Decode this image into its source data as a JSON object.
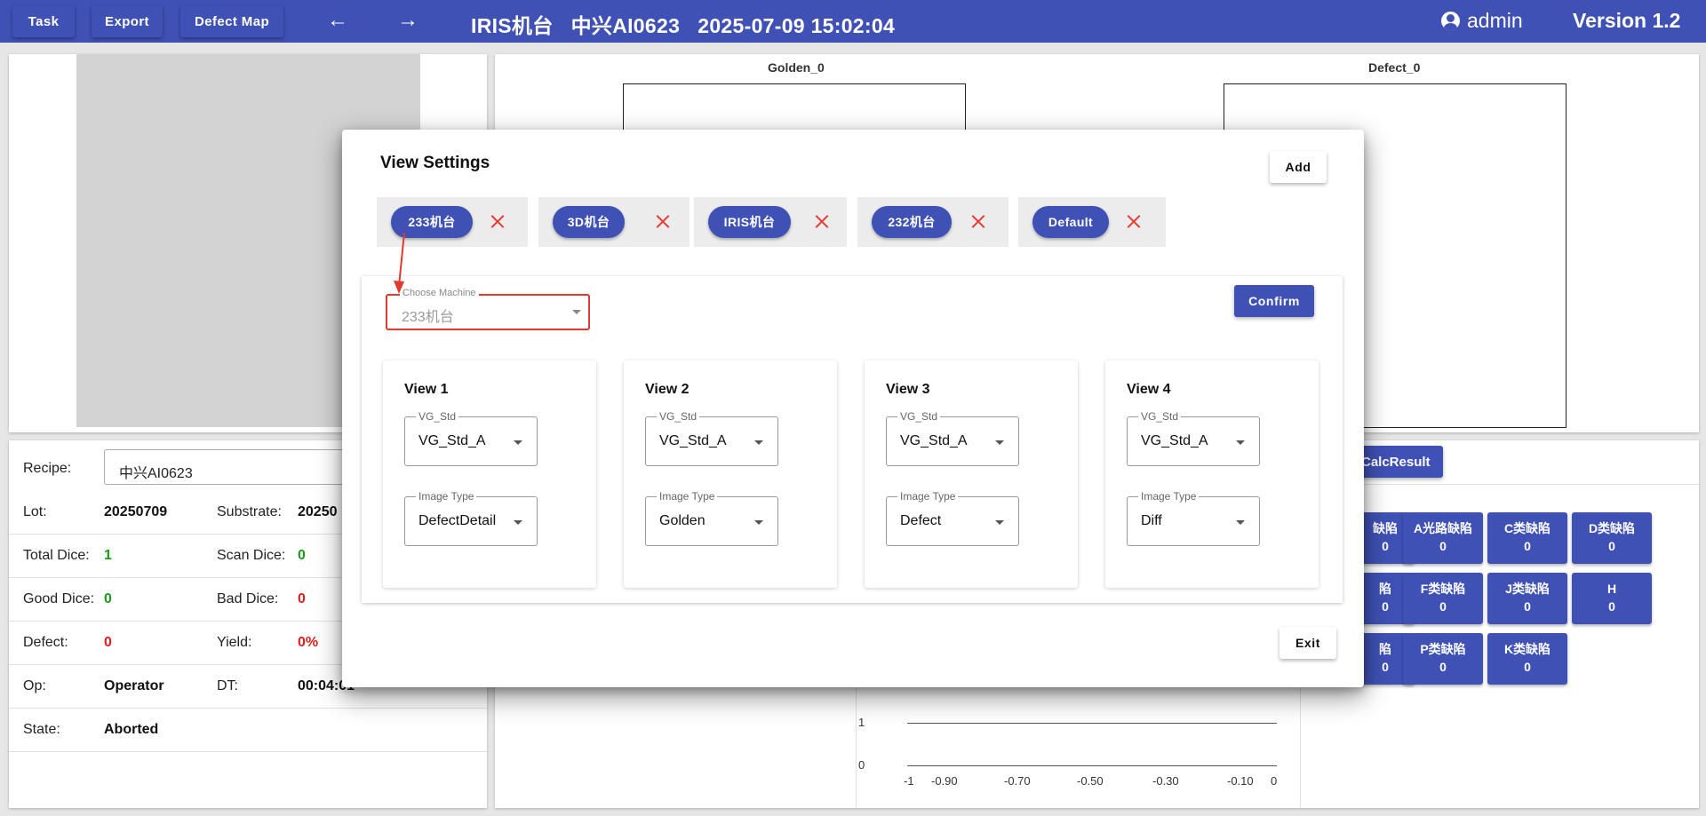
{
  "topbar": {
    "task": "Task",
    "export": "Export",
    "defect_map": "Defect Map",
    "back_icon": "←",
    "forward_icon": "→",
    "title": "IRIS机台   中兴AI0623   2025-07-09 15:02:04",
    "user": "admin",
    "version": "Version 1.2",
    "color": "#3f51b5"
  },
  "images": {
    "golden_label": "Golden_0",
    "defect_label": "Defect_0"
  },
  "info": {
    "recipe_label": "Recipe:",
    "recipe_value": "中兴AI0623",
    "lot_label": "Lot:",
    "lot_value": "20250709",
    "substrate_label": "Substrate:",
    "substrate_value": "20250",
    "total_dice_label": "Total Dice:",
    "total_dice_value": "1",
    "scan_dice_label": "Scan Dice:",
    "scan_dice_value": "0",
    "good_dice_label": "Good Dice:",
    "good_dice_value": "0",
    "bad_dice_label": "Bad Dice:",
    "bad_dice_value": "0",
    "defect_label": "Defect:",
    "defect_value": "0",
    "yield_label": "Yield:",
    "yield_value": "0%",
    "op_label": "Op:",
    "op_value": "Operator",
    "dt_label": "DT:",
    "dt_value": "00:04:01",
    "state_label": "State:",
    "state_value": "Aborted"
  },
  "calc_result": "CalcResult",
  "defect_tiles": [
    {
      "name": "缺陷",
      "count": "0"
    },
    {
      "name": "A光路缺陷",
      "count": "0"
    },
    {
      "name": "C类缺陷",
      "count": "0"
    },
    {
      "name": "D类缺陷",
      "count": "0"
    },
    {
      "name": "陷",
      "count": "0"
    },
    {
      "name": "F类缺陷",
      "count": "0"
    },
    {
      "name": "J类缺陷",
      "count": "0"
    },
    {
      "name": "H",
      "count": "0"
    },
    {
      "name": "陷",
      "count": "0"
    },
    {
      "name": "P类缺陷",
      "count": "0"
    },
    {
      "name": "K类缺陷",
      "count": "0"
    }
  ],
  "chart": {
    "y_ticks": [
      "1",
      "0"
    ],
    "x_ticks": [
      "-1",
      "-0.90",
      "-0.70",
      "-0.50",
      "-0.30",
      "-0.10",
      "0"
    ]
  },
  "dialog": {
    "title": "View Settings",
    "add": "Add",
    "chips": [
      "233机台",
      "3D机台",
      "IRIS机台",
      "232机台",
      "Default"
    ],
    "choose_machine_label": "Choose Machine",
    "choose_machine_value": "233机台",
    "confirm": "Confirm",
    "exit": "Exit",
    "views": [
      {
        "title": "View 1",
        "vg_label": "VG_Std",
        "vg_value": "VG_Std_A",
        "type_label": "Image Type",
        "type_value": "DefectDetail"
      },
      {
        "title": "View 2",
        "vg_label": "VG_Std",
        "vg_value": "VG_Std_A",
        "type_label": "Image Type",
        "type_value": "Golden"
      },
      {
        "title": "View 3",
        "vg_label": "VG_Std",
        "vg_value": "VG_Std_A",
        "type_label": "Image Type",
        "type_value": "Defect"
      },
      {
        "title": "View 4",
        "vg_label": "VG_Std",
        "vg_value": "VG_Std_A",
        "type_label": "Image Type",
        "type_value": "Diff"
      }
    ],
    "annotation_color": "#e03a2e"
  }
}
